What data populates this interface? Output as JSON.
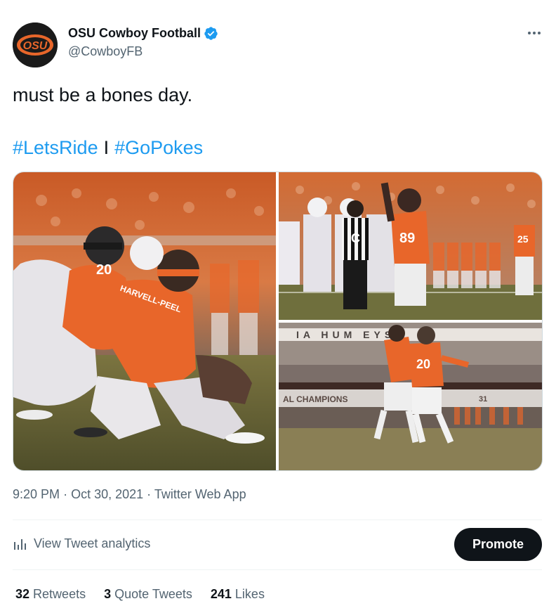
{
  "author": {
    "display_name": "OSU Cowboy Football",
    "handle": "@CowboyFB",
    "avatar_text": "OSU",
    "verified_icon": "verified-badge-icon",
    "more_icon": "more-horizontal-icon"
  },
  "tweet": {
    "text": "must be a bones day.",
    "hashtags": [
      "#LetsRide",
      "#GoPokes"
    ],
    "hashtag_separator": "I"
  },
  "media": {
    "photo_1": {
      "jersey_left": "20",
      "nameplate": "HARVELL-PEEL"
    },
    "photo_2": {
      "jersey": "89",
      "jersey_back": "25",
      "ref_letter": "C"
    },
    "photo_3": {
      "banner": "IA   HUM   EYS",
      "jersey": "20",
      "wall_text": "AL CHAMPIONS",
      "bowl_text": "31"
    }
  },
  "meta": {
    "time": "9:20 PM",
    "date": "Oct 30, 2021",
    "source": "Twitter Web App",
    "dot": "·"
  },
  "actions": {
    "analytics_label": "View Tweet analytics",
    "promote_label": "Promote"
  },
  "stats": {
    "retweets_count": "32",
    "retweets_label": "Retweets",
    "quotes_count": "3",
    "quotes_label": "Quote Tweets",
    "likes_count": "241",
    "likes_label": "Likes"
  },
  "colors": {
    "link": "#1d9bf0",
    "text": "#0f1419",
    "secondary": "#536471",
    "osu_orange": "#e8662a"
  }
}
